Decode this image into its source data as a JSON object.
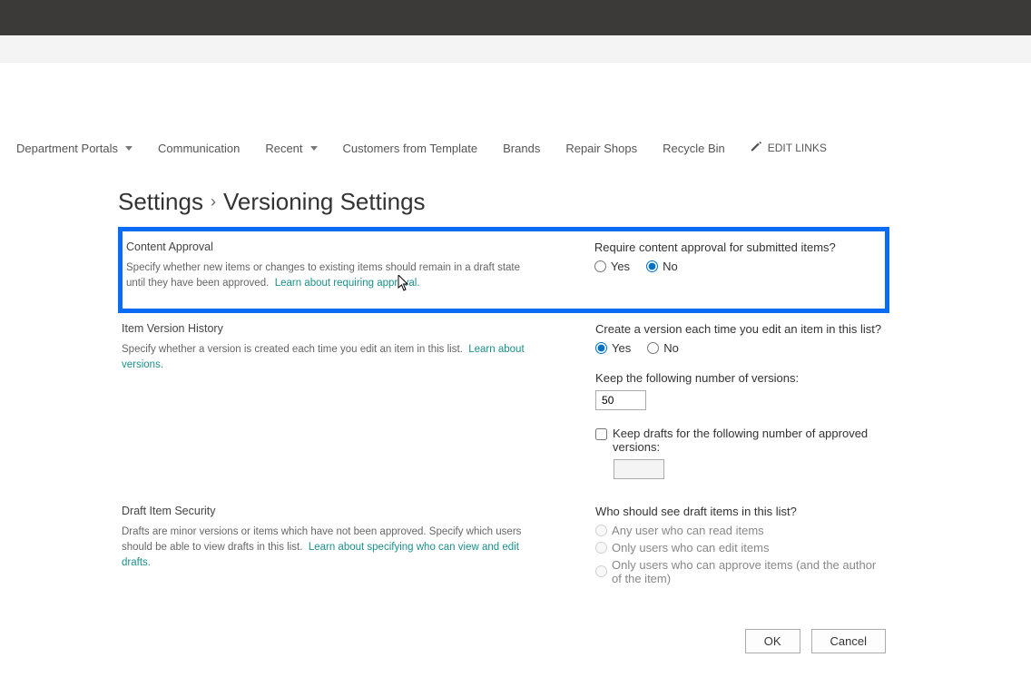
{
  "nav": {
    "items": [
      {
        "label": "Department Portals",
        "hasDropdown": true
      },
      {
        "label": "Communication",
        "hasDropdown": false
      },
      {
        "label": "Recent",
        "hasDropdown": true
      },
      {
        "label": "Customers from Template",
        "hasDropdown": false
      },
      {
        "label": "Brands",
        "hasDropdown": false
      },
      {
        "label": "Repair Shops",
        "hasDropdown": false
      },
      {
        "label": "Recycle Bin",
        "hasDropdown": false
      }
    ],
    "editLinks": "EDIT LINKS"
  },
  "breadcrumb": {
    "root": "Settings",
    "page": "Versioning Settings"
  },
  "sections": {
    "contentApproval": {
      "title": "Content Approval",
      "desc": "Specify whether new items or changes to existing items should remain in a draft state until they have been approved.",
      "learn": "Learn about requiring approval.",
      "question": "Require content approval for submitted items?",
      "yes": "Yes",
      "no": "No",
      "selected": "no"
    },
    "versionHistory": {
      "title": "Item Version History",
      "desc": "Specify whether a version is created each time you edit an item in this list.",
      "learn": "Learn about versions.",
      "question": "Create a version each time you edit an item in this list?",
      "yes": "Yes",
      "no": "No",
      "selected": "yes",
      "keepVersionsLabel": "Keep the following number of versions:",
      "keepVersionsValue": "50",
      "keepDraftsLabel": "Keep drafts for the following number of approved versions:",
      "keepDraftsChecked": false,
      "keepDraftsValue": ""
    },
    "draftSecurity": {
      "title": "Draft Item Security",
      "desc": "Drafts are minor versions or items which have not been approved. Specify which users should be able to view drafts in this list.",
      "learn": "Learn about specifying who can view and edit drafts.",
      "question": "Who should see draft items in this list?",
      "opt1": "Any user who can read items",
      "opt2": "Only users who can edit items",
      "opt3": "Only users who can approve items (and the author of the item)",
      "selected": "opt1"
    }
  },
  "buttons": {
    "ok": "OK",
    "cancel": "Cancel"
  }
}
